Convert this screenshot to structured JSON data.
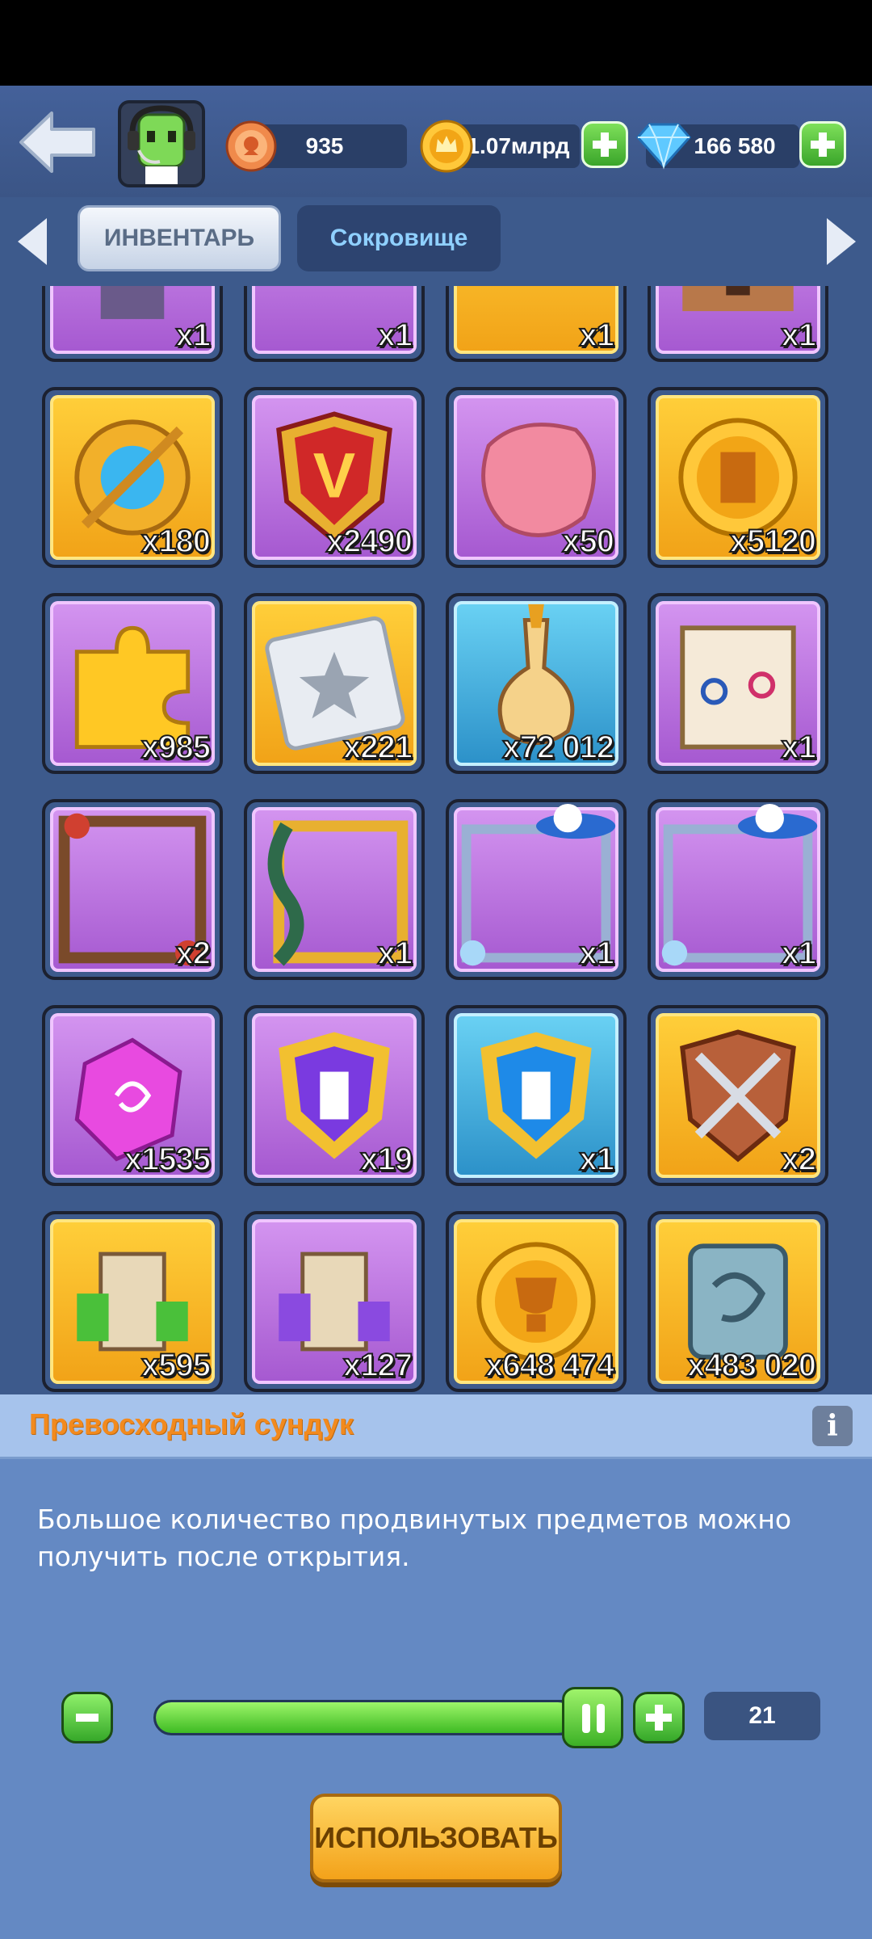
{
  "header": {
    "back_icon": "back-arrow-icon",
    "avatar_icon": "player-avatar-icon",
    "currencies": [
      {
        "icon": "medal-coin-icon",
        "value": "935"
      },
      {
        "icon": "gold-coin-icon",
        "value": "1.07млрд"
      },
      {
        "icon": "diamond-icon",
        "value": "166 580"
      }
    ],
    "plus_icon": "plus-icon"
  },
  "tabs": {
    "inventory": "ИНВЕНТАРЬ",
    "treasure": "Сокровище"
  },
  "inventory_items": [
    {
      "row": 0,
      "col": 0,
      "rarity": "purple",
      "icon": "castle-tower-icon",
      "qty": "x1"
    },
    {
      "row": 0,
      "col": 1,
      "rarity": "purple",
      "icon": "golden-frame-icon",
      "qty": "x1"
    },
    {
      "row": 0,
      "col": 2,
      "rarity": "gold",
      "icon": "crown-icon",
      "qty": "x1"
    },
    {
      "row": 0,
      "col": 3,
      "rarity": "purple",
      "icon": "fortress-icon",
      "qty": "x1"
    },
    {
      "row": 1,
      "col": 0,
      "rarity": "gold",
      "icon": "compass-gem-icon",
      "qty": "x180"
    },
    {
      "row": 1,
      "col": 1,
      "rarity": "purple",
      "icon": "v-badge-shield-icon",
      "qty": "x2490"
    },
    {
      "row": 1,
      "col": 2,
      "rarity": "purple",
      "icon": "pink-meat-icon",
      "qty": "x50"
    },
    {
      "row": 1,
      "col": 3,
      "rarity": "gold",
      "icon": "rook-coin-icon",
      "qty": "x5120"
    },
    {
      "row": 2,
      "col": 0,
      "rarity": "purple",
      "icon": "puzzle-piece-icon",
      "qty": "x985"
    },
    {
      "row": 2,
      "col": 1,
      "rarity": "gold",
      "icon": "star-ticket-icon",
      "qty": "x221"
    },
    {
      "row": 2,
      "col": 2,
      "rarity": "blue",
      "icon": "potion-bottle-icon",
      "qty": "x72 012"
    },
    {
      "row": 2,
      "col": 3,
      "rarity": "purple",
      "icon": "gender-change-note-icon",
      "qty": "x1"
    },
    {
      "row": 3,
      "col": 0,
      "rarity": "purple",
      "icon": "mushroom-vine-frame-icon",
      "qty": "x2"
    },
    {
      "row": 3,
      "col": 1,
      "rarity": "purple",
      "icon": "serpent-gold-frame-icon",
      "qty": "x1"
    },
    {
      "row": 3,
      "col": 2,
      "rarity": "purple",
      "icon": "blue-hat-frame-icon",
      "qty": "x1"
    },
    {
      "row": 3,
      "col": 3,
      "rarity": "purple",
      "icon": "blue-hat-frame-icon",
      "qty": "x1"
    },
    {
      "row": 4,
      "col": 0,
      "rarity": "purple",
      "icon": "purple-gem-icon",
      "qty": "x1535"
    },
    {
      "row": 4,
      "col": 1,
      "rarity": "purple",
      "icon": "tower-shield-purple-icon",
      "qty": "x19"
    },
    {
      "row": 4,
      "col": 2,
      "rarity": "blue",
      "icon": "tower-shield-blue-icon",
      "qty": "x1"
    },
    {
      "row": 4,
      "col": 3,
      "rarity": "gold",
      "icon": "crossed-swords-shield-icon",
      "qty": "x2"
    },
    {
      "row": 5,
      "col": 0,
      "rarity": "gold",
      "icon": "green-tower-puzzle-icon",
      "qty": "x595"
    },
    {
      "row": 5,
      "col": 1,
      "rarity": "purple",
      "icon": "purple-tower-puzzle-icon",
      "qty": "x127"
    },
    {
      "row": 5,
      "col": 2,
      "rarity": "gold",
      "icon": "trophy-coin-icon",
      "qty": "x648 474"
    },
    {
      "row": 5,
      "col": 3,
      "rarity": "gold",
      "icon": "stone-tablet-icon",
      "qty": "x483 020"
    }
  ],
  "detail": {
    "title": "Превосходный сундук",
    "info_label": "i",
    "description": "Большое количество продвинутых предметов можно получить после открытия.",
    "minus_label": "−",
    "plus_label": "+",
    "slider_fraction": 0.9,
    "count": "21",
    "use_label": "ИСПОЛЬЗОВАТЬ"
  },
  "colors": {
    "background": "#3d5a8c",
    "gold_rarity": "#f1a217",
    "purple_rarity": "#a558d0",
    "blue_rarity": "#2b90c8",
    "title_orange": "#f28a1e",
    "green_button": "#3aa52a"
  }
}
